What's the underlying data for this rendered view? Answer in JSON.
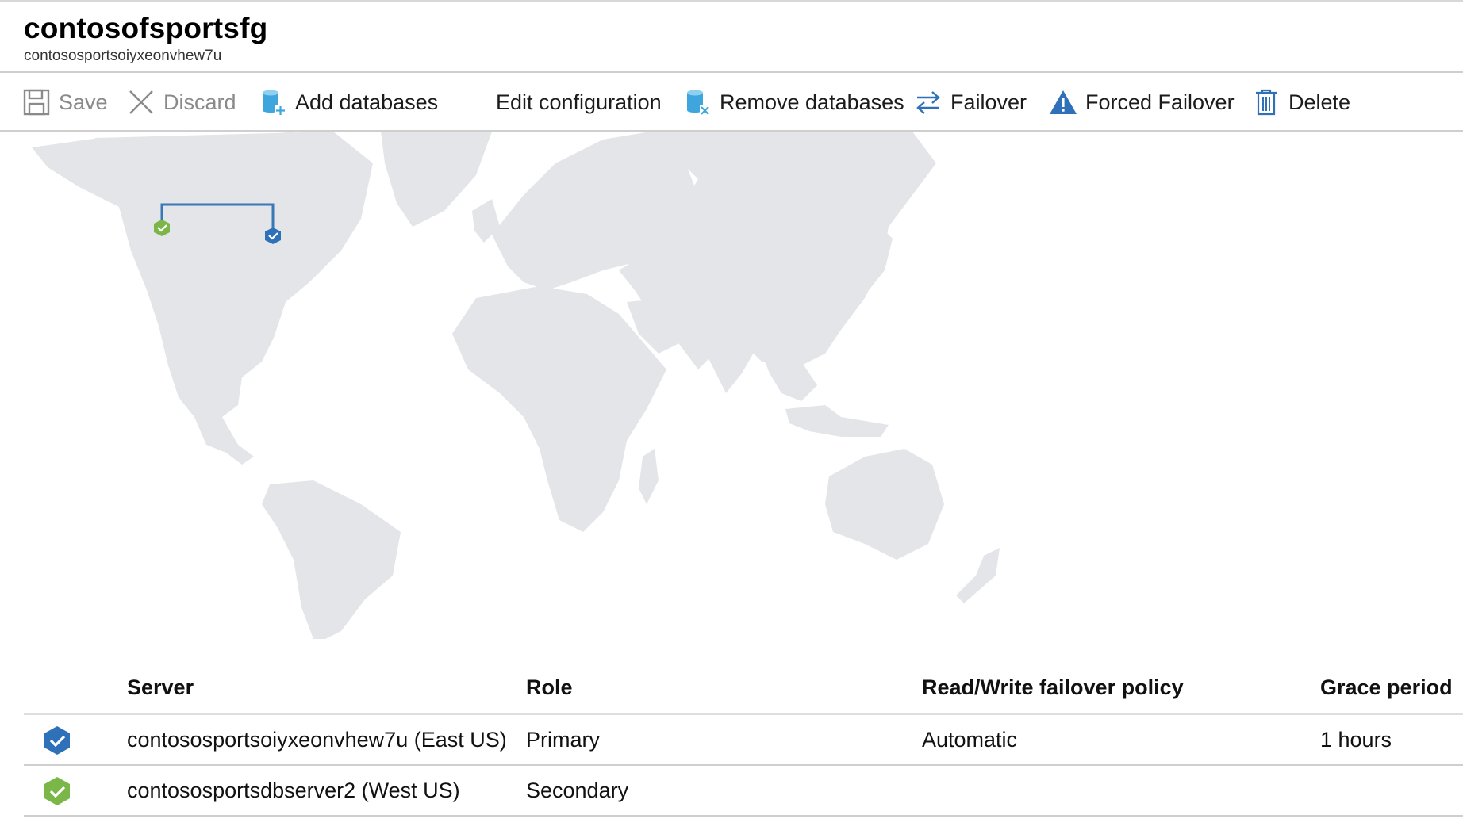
{
  "header": {
    "title": "contosofsportsfg",
    "subtitle": "contososportsoiyxeonvhew7u"
  },
  "toolbar": {
    "save": {
      "label": "Save",
      "icon": "save-icon",
      "disabled": true
    },
    "discard": {
      "label": "Discard",
      "icon": "close-icon",
      "disabled": true
    },
    "add_databases": {
      "label": "Add databases",
      "icon": "database-add-icon"
    },
    "edit_configuration": {
      "label": "Edit configuration"
    },
    "remove_databases": {
      "label": "Remove databases",
      "icon": "database-remove-icon"
    },
    "failover": {
      "label": "Failover",
      "icon": "swap-arrows-icon"
    },
    "forced_failover": {
      "label": "Forced Failover",
      "icon": "warning-icon"
    },
    "delete": {
      "label": "Delete",
      "icon": "trash-icon"
    }
  },
  "map": {
    "primary_marker": {
      "region": "East US",
      "icon": "primary-server-icon",
      "color": "#2f71b8"
    },
    "secondary_marker": {
      "region": "West US",
      "icon": "secondary-server-icon",
      "color": "#7ab648"
    },
    "link_color": "#3a78b8",
    "land_color": "#e3e5e8"
  },
  "table": {
    "headers": {
      "server": "Server",
      "role": "Role",
      "policy": "Read/Write failover policy",
      "grace": "Grace period"
    },
    "rows": [
      {
        "server": "contososportsoiyxeonvhew7u (East US)",
        "role": "Primary",
        "policy": "Automatic",
        "grace": "1 hours",
        "icon": "primary-server-icon"
      },
      {
        "server": "contososportsdbserver2 (West US)",
        "role": "Secondary",
        "policy": "",
        "grace": "",
        "icon": "secondary-server-icon"
      }
    ]
  },
  "colors": {
    "accent_blue": "#2f71b8",
    "accent_green": "#7ab648",
    "disabled_text": "#8a8a8a"
  }
}
